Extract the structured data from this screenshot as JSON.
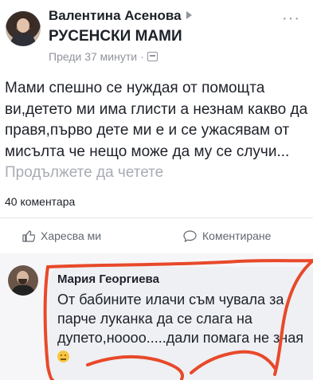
{
  "post": {
    "author": "Валентина Асенова",
    "group": "РУСЕНСКИ МАМИ",
    "timestamp": "Преди 37 минути",
    "audience_icon": "globe-icon",
    "text": "Мами спешно се нуждая от помощта ви,детето ми има глисти а незнам какво да правя,първо дете ми е и се ужасявам от мисълта че нещо може да му се случи...",
    "see_more": "Продължете да четете",
    "comment_count": "40 коментара"
  },
  "actions": {
    "like_label": "Харесва ми",
    "comment_label": "Коментиране"
  },
  "comment": {
    "author": "Мария Георгиева",
    "text": "От бабините илачи съм чувала за парче луканка да се слага на дупето,ноооо.....дали помага не зная"
  },
  "colors": {
    "annotation_stroke": "#e8492a",
    "meta_gray": "#90949c",
    "bubble_bg": "#eef0f3"
  }
}
